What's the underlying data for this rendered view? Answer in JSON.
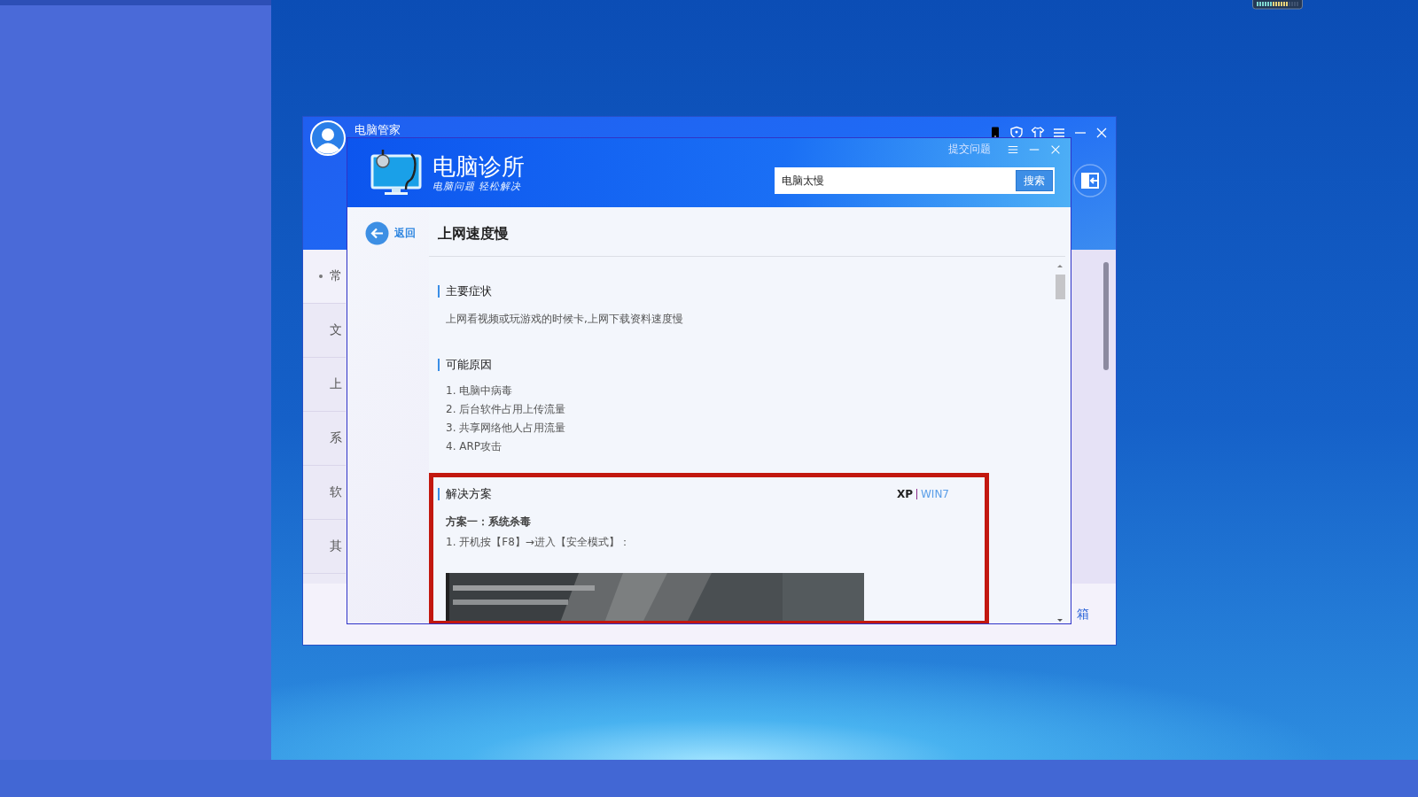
{
  "back_window": {
    "title": "电脑管家",
    "sidebar_items": [
      {
        "label": "常",
        "selected": true
      },
      {
        "label": "文",
        "selected": false
      },
      {
        "label": "上",
        "selected": false
      },
      {
        "label": "系",
        "selected": false
      },
      {
        "label": "软",
        "selected": false
      },
      {
        "label": "其",
        "selected": false
      }
    ],
    "bottom_label": "箱"
  },
  "clinic_window": {
    "title": "电脑诊所",
    "subtitle": "电脑问题 轻松解决",
    "submit_link": "提交问题",
    "search": {
      "value": "电脑太慢",
      "button": "搜索"
    },
    "back_link": "返回",
    "article": {
      "title": "上网速度慢",
      "sections": [
        {
          "kind": "paragraph",
          "heading": "主要症状",
          "text": "上网看视频或玩游戏的时候卡,上网下载资料速度慢"
        },
        {
          "kind": "list",
          "heading": "可能原因",
          "items": [
            "1. 电脑中病毒",
            "2. 后台软件占用上传流量",
            "3. 共享网络他人占用流量",
            "4. ARP攻击"
          ]
        },
        {
          "kind": "solution",
          "heading": "解决方案",
          "os_tabs": [
            {
              "label": "XP",
              "selected": true
            },
            {
              "label": "WIN7",
              "selected": false
            }
          ],
          "plan_title": "方案一：系统杀毒",
          "steps": [
            "1. 开机按【F8】→进入【安全模式】："
          ],
          "image": {
            "kind": "picture"
          }
        }
      ]
    }
  }
}
